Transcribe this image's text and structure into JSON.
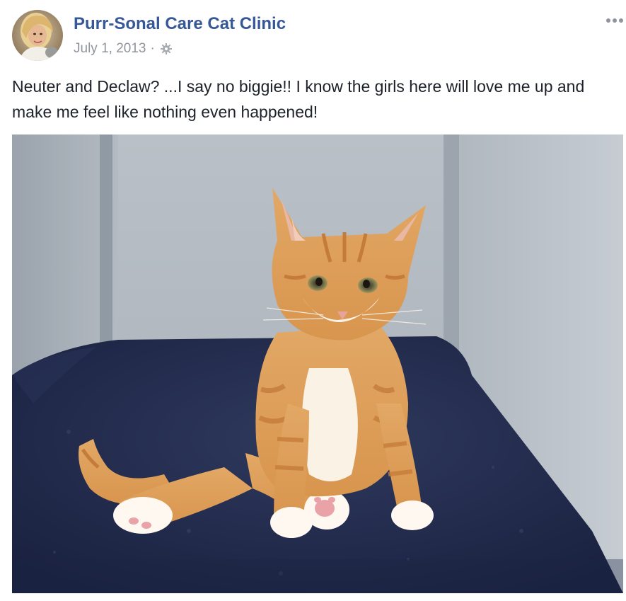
{
  "post": {
    "author": "Purr-Sonal Care Cat Clinic",
    "date": "July 1, 2013",
    "separator": "·",
    "audience_icon": "gear-icon",
    "more_icon": "more-options-icon",
    "message": "Neuter and Declaw? ...I say no biggie!! I know the girls here will love me up and make me feel like nothing even happened!"
  },
  "colors": {
    "author_link": "#365899",
    "meta_text": "#90949c",
    "body_text": "#1d2129"
  }
}
